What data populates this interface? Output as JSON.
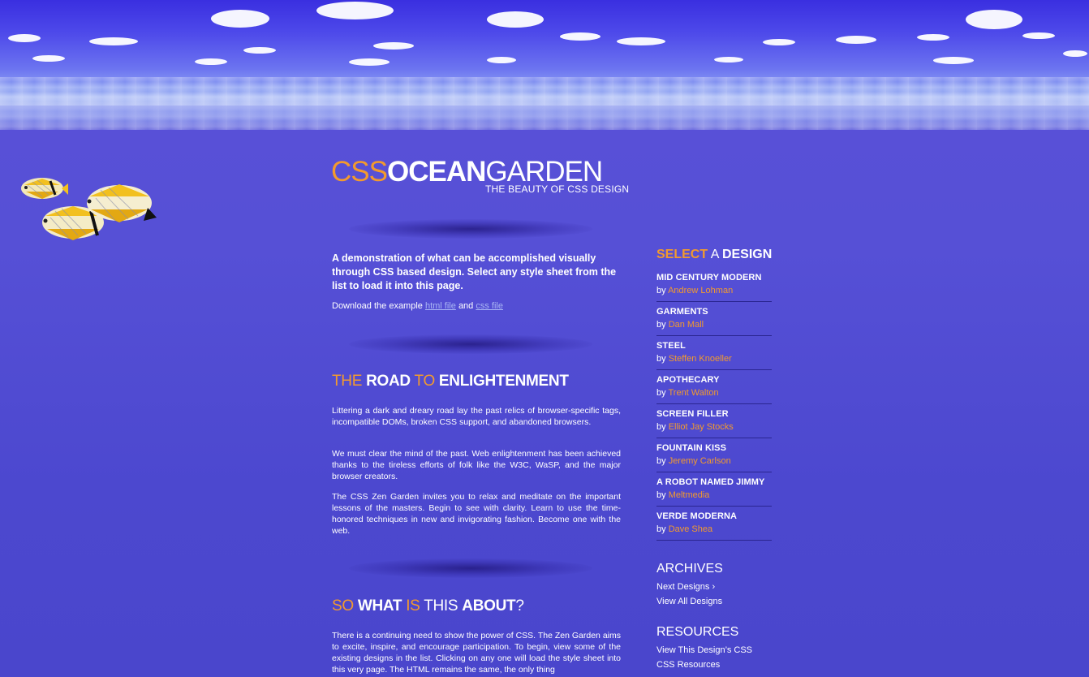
{
  "logo": {
    "part1": "CSS",
    "part2": "OCEAN",
    "part3": "GARDEN",
    "tagline": "THE BEAUTY OF CSS DESIGN"
  },
  "intro": {
    "text": "A demonstration of what can be accomplished visually through CSS based design.  Select any style sheet from the list to load it into this page.",
    "download_prefix": "Download the example",
    "html_link": "html file",
    "and": "and",
    "css_link": "css file"
  },
  "road": {
    "w1": "THE",
    "w2": "ROAD",
    "w3": "TO",
    "w4": "ENLIGHTENMENT",
    "p1": "Littering a dark and dreary road lay the past relics of browser-specific tags, incompatible DOMs, broken CSS support, and abandoned browsers.",
    "p2": "We must clear the mind of the past. Web enlightenment has been achieved thanks to the tireless efforts of folk like the W3C, WaSP, and the major browser creators.",
    "p3": "The CSS Zen Garden invites you to relax and meditate on the important lessons of the masters. Begin to see with clarity. Learn to use the time-honored techniques in new and invigorating fashion. Become one with the web."
  },
  "about": {
    "w1": "SO",
    "w2": "WHAT",
    "w3": "IS",
    "w4": "THIS",
    "w5": "ABOUT",
    "w6": "?",
    "p1": "There is a continuing need to show the power of CSS. The Zen Garden aims to excite, inspire, and encourage participation. To begin, view some of the existing designs in the list. Clicking on any one will load the style sheet into this very page. The HTML remains the same, the only thing"
  },
  "sidebar": {
    "select_w1": "SELECT",
    "select_w2": "A",
    "select_w3": "DESIGN",
    "by": "by",
    "designs": [
      {
        "name": "MID CENTURY MODERN",
        "author": "Andrew Lohman"
      },
      {
        "name": "GARMENTS",
        "author": "Dan Mall"
      },
      {
        "name": "STEEL",
        "author": "Steffen Knoeller"
      },
      {
        "name": "APOTHECARY",
        "author": "Trent Walton"
      },
      {
        "name": "SCREEN FILLER",
        "author": "Elliot Jay Stocks"
      },
      {
        "name": "FOUNTAIN KISS",
        "author": "Jeremy Carlson"
      },
      {
        "name": "A ROBOT NAMED JIMMY",
        "author": "Meltmedia"
      },
      {
        "name": "VERDE MODERNA",
        "author": "Dave Shea"
      }
    ],
    "archives_title": "ARCHIVES",
    "next_designs": "Next Designs ›",
    "view_all": "View All Designs",
    "resources_title": "RESOURCES",
    "view_css": "View This Design’s CSS",
    "css_resources": "CSS Resources"
  },
  "colors": {
    "accent": "#f29a2e",
    "background": "#5650d6"
  }
}
